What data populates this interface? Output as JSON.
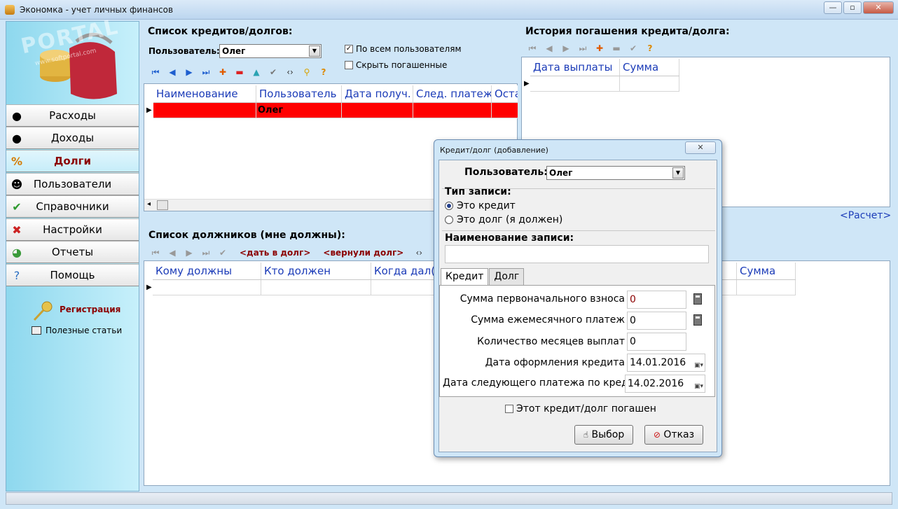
{
  "window": {
    "title": "Экономка - учет личных финансов",
    "minimize": "—",
    "maximize": "▫",
    "close": "✕",
    "watermark": "PORTAL",
    "watermark_sub": "www.softportal.com"
  },
  "sidebar": {
    "items": [
      {
        "label": "Расходы"
      },
      {
        "label": "Доходы"
      },
      {
        "label": "Долги"
      },
      {
        "label": "Пользователи"
      },
      {
        "label": "Справочники"
      },
      {
        "label": "Настройки"
      },
      {
        "label": "Отчеты"
      },
      {
        "label": "Помощь"
      }
    ],
    "registration": "Регистрация",
    "useful_articles": "Полезные статьи"
  },
  "credits": {
    "title": "Список кредитов/долгов:",
    "user_label": "Пользователь:",
    "user_value": "Олег",
    "all_users_label": "По всем пользователям",
    "all_users_checked": true,
    "hide_paid_label": "Скрыть погашенные",
    "hide_paid_checked": false,
    "columns": [
      "Наименование",
      "Пользователь",
      "Дата получ.",
      "След. платеж",
      "Оста"
    ],
    "rows": [
      {
        "name": "",
        "user": "Олег",
        "date": "",
        "next": "",
        "rest": ""
      }
    ],
    "scroll_left": "◂"
  },
  "history": {
    "title": "История погашения кредита/долга:",
    "columns": [
      "Дата выплаты",
      "Сумма"
    ],
    "calc_link": "<Расчет>"
  },
  "debtors": {
    "title": "Список должников (мне должны):",
    "lend_link": "<дать в долг>",
    "returned_link": "<вернули долг>",
    "columns": [
      "Кому должны",
      "Кто должен",
      "Когда дал(а",
      "Сумма"
    ]
  },
  "dialog": {
    "title": "Кредит/долг (добавление)",
    "user_label": "Пользователь:",
    "user_value": "Олег",
    "record_type_label": "Тип записи:",
    "radio_credit": "Это кредит",
    "radio_debt": "Это долг (я должен)",
    "name_label": "Наименование записи:",
    "name_value": "",
    "tabs": [
      "Кредит",
      "Долг"
    ],
    "fields": [
      {
        "label": "Сумма первоначального взноса",
        "value": "0"
      },
      {
        "label": "Сумма ежемесячного платеж",
        "value": "0"
      },
      {
        "label": "Количество месяцев выплат",
        "value": "0"
      },
      {
        "label": "Дата оформления кредита",
        "value": "14.01.2016"
      },
      {
        "label": "Дата следующего платежа по кредит",
        "value": "14.02.2016"
      }
    ],
    "paid_label": "Этот кредит/долг погашен",
    "paid_checked": false,
    "ok_label": "Выбор",
    "cancel_label": "Отказ"
  },
  "colors": {
    "selected_row": "#ff0000",
    "header_text": "#1c3cb8",
    "active_nav": "#8b0000",
    "accent_links": "#8b0000"
  }
}
